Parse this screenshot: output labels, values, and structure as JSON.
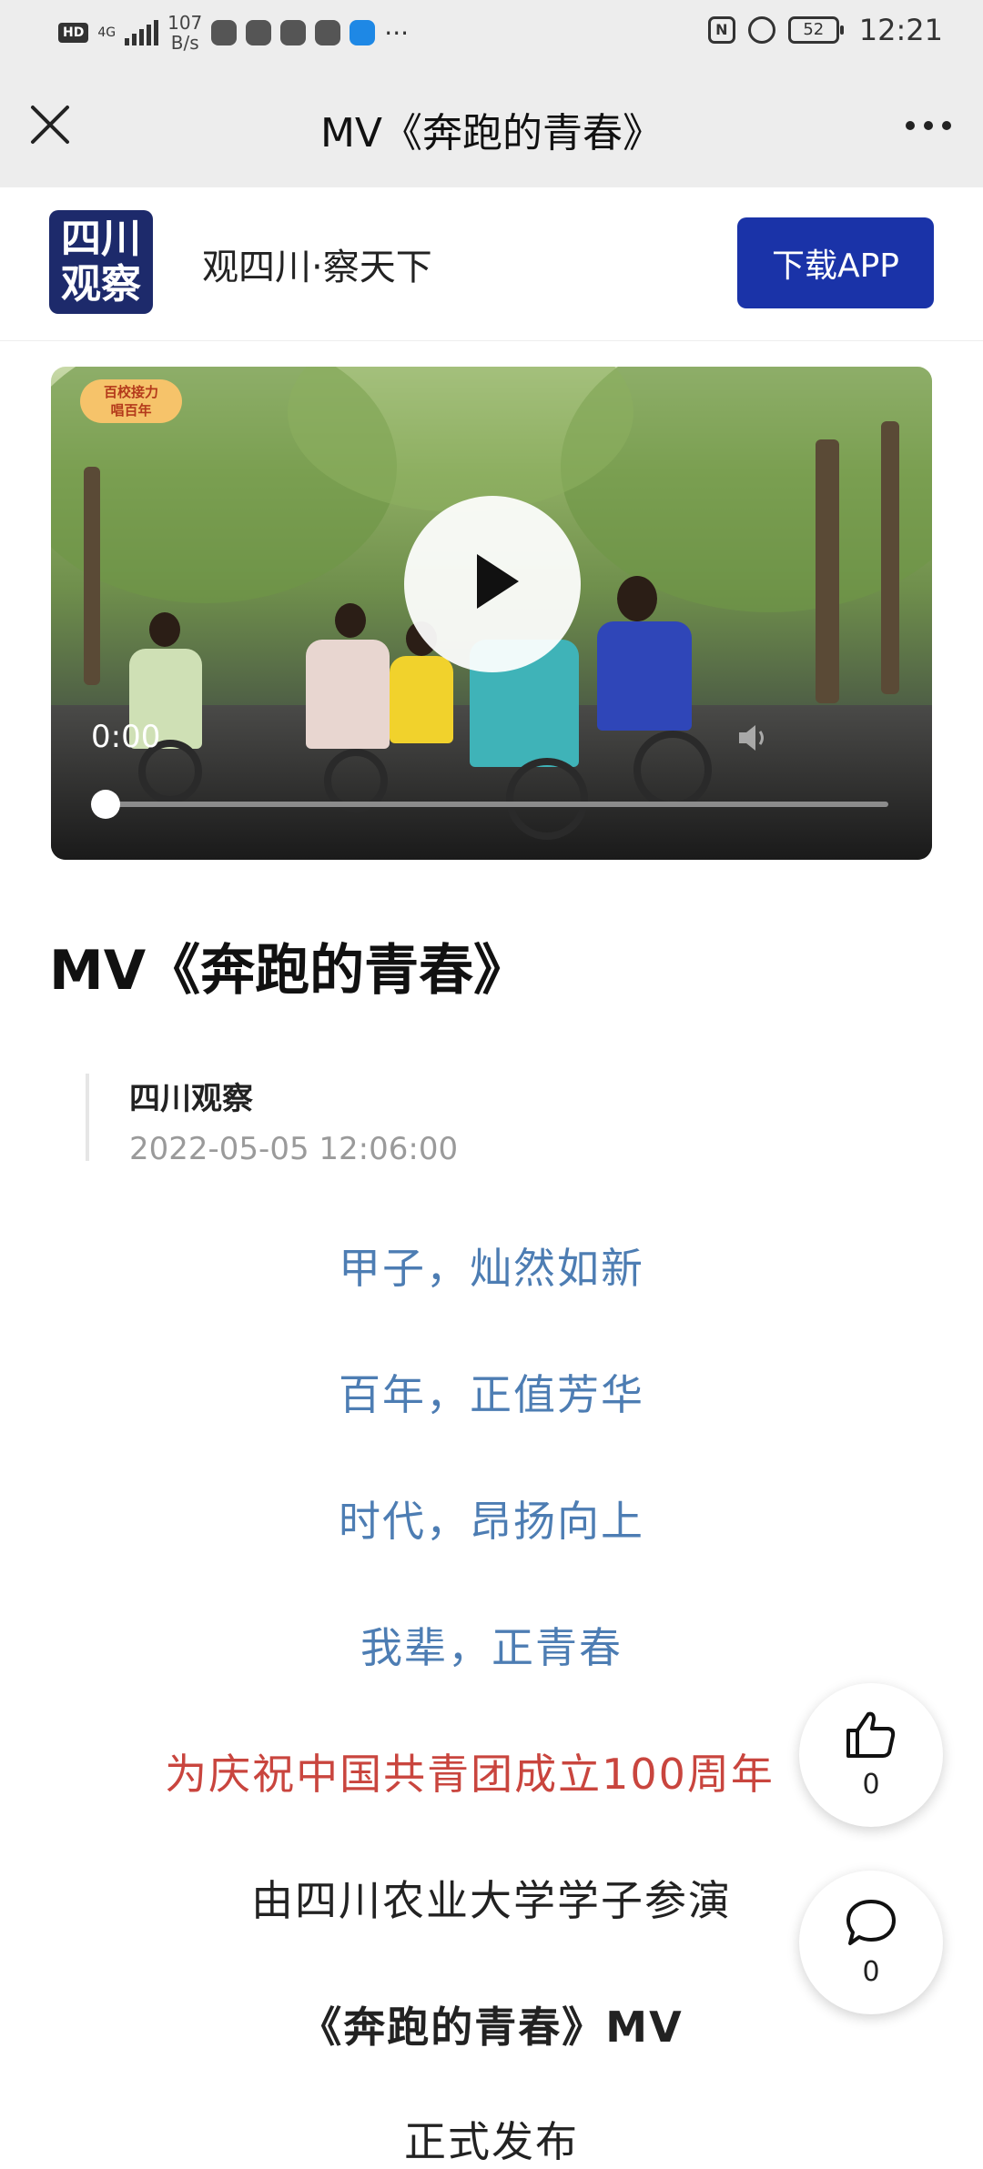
{
  "status_bar": {
    "hd": "HD",
    "network": "4G",
    "speed_value": "107",
    "speed_unit": "B/s",
    "nfc": "N",
    "battery": "52",
    "time": "12:21"
  },
  "title_bar": {
    "title": "MV《奔跑的青春》"
  },
  "banner": {
    "logo_line1": "四川",
    "logo_line2": "观察",
    "slogan": "观四川·察天下",
    "download_label": "下载APP"
  },
  "video": {
    "badge_line1": "百校接力",
    "badge_line2": "唱百年",
    "current_time": "0:00",
    "progress": 0
  },
  "article": {
    "title": "MV《奔跑的青春》",
    "author": "四川观察",
    "date": "2022-05-05 12:06:00",
    "lines": [
      "甲子，灿然如新",
      "百年，正值芳华",
      "时代，昂扬向上",
      "我辈，正青春",
      "为庆祝中国共青团成立100周年",
      "由四川农业大学学子参演",
      "《奔跑的青春》MV"
    ],
    "partial_line": "正式发布"
  },
  "actions": {
    "like_count": "0",
    "comment_count": "0"
  },
  "colors": {
    "accent_blue": "#1a33a8",
    "lyric_blue": "#4d7db3",
    "highlight_red": "#c9453e"
  }
}
